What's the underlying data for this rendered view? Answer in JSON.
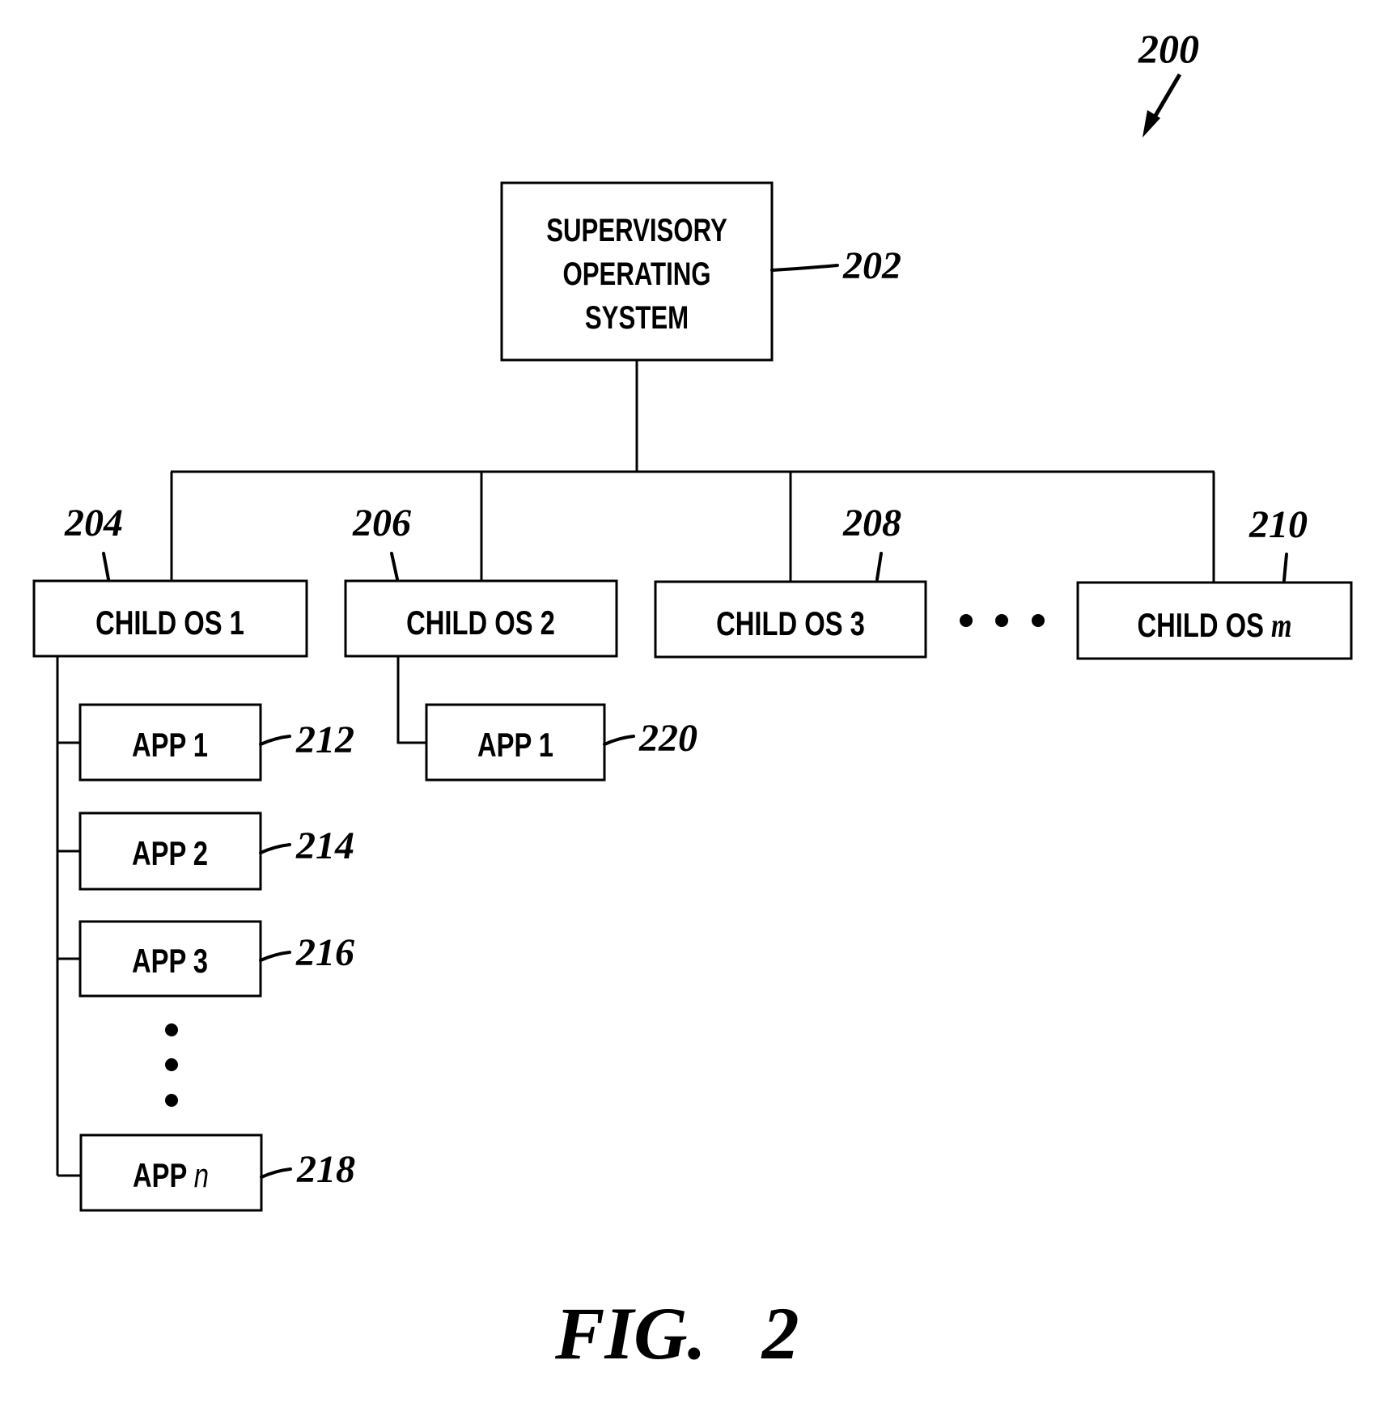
{
  "figure": {
    "number_label": "200",
    "caption": "FIG. 2"
  },
  "supervisory": {
    "lines": [
      "SUPERVISORY",
      "OPERATING",
      "SYSTEM"
    ],
    "ref": "202"
  },
  "children": [
    {
      "label": "CHILD OS 1",
      "ref": "204"
    },
    {
      "label": "CHILD OS 2",
      "ref": "206"
    },
    {
      "label": "CHILD OS 3",
      "ref": "208"
    },
    {
      "label_prefix": "CHILD OS ",
      "label_var": "m",
      "ref": "210"
    }
  ],
  "child1_apps": [
    {
      "label": "APP 1",
      "ref": "212"
    },
    {
      "label": "APP 2",
      "ref": "214"
    },
    {
      "label": "APP 3",
      "ref": "216"
    },
    {
      "label_prefix": "APP ",
      "label_var": "n",
      "ref": "218"
    }
  ],
  "child2_apps": [
    {
      "label": "APP 1",
      "ref": "220"
    }
  ],
  "ellipsis_horizontal": "• • •",
  "ellipsis_vertical": "⋮"
}
